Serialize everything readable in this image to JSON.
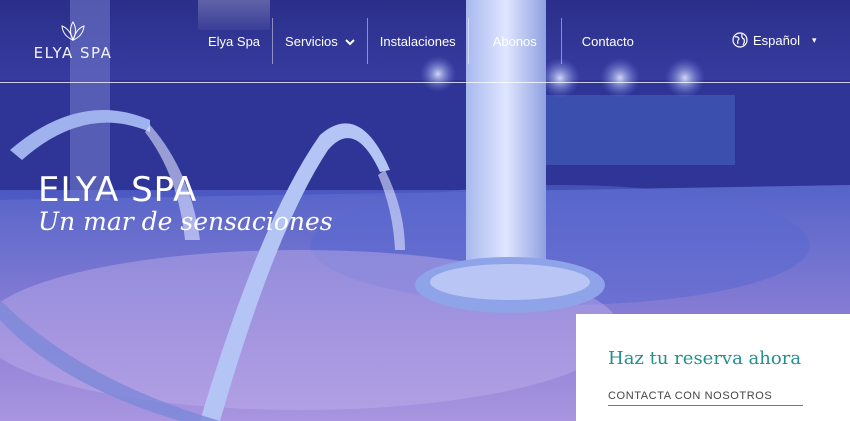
{
  "brand": {
    "logo_text": "ELYA SPA"
  },
  "nav": {
    "items": [
      {
        "label": "Elya Spa"
      },
      {
        "label": "Servicios"
      },
      {
        "label": "Instalaciones"
      },
      {
        "label": "Abonos"
      },
      {
        "label": "Contacto"
      }
    ]
  },
  "language": {
    "label": "Español"
  },
  "hero": {
    "title": "ELYA SPA",
    "subtitle": "Un mar de sensaciones"
  },
  "booking": {
    "title": "Haz tu reserva ahora",
    "link": "CONTACTA CON NOSOTROS"
  },
  "colors": {
    "accent": "#238f8c",
    "hero_blue": "#3b3fa6"
  }
}
